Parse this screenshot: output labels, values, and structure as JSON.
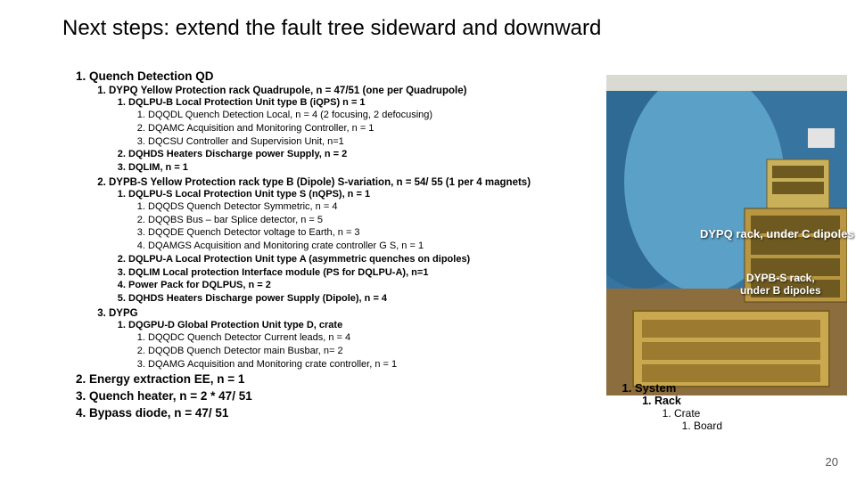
{
  "title": "Next steps: extend the fault tree sideward and downward",
  "outline": {
    "lvl1": {
      "item1": "Quench Detection QD",
      "sub1": {
        "s1": "DYPQ Yellow Protection rack Quadrupole, n = 47/51 (one per Quadrupole)",
        "s1_1": "DQLPU-B Local Protection Unit type B (iQPS) n = 1",
        "s1_1_1": "DQQDL Quench Detection Local, n = 4 (2 focusing, 2 defocusing)",
        "s1_1_2": "DQAMC Acquisition and Monitoring Controller, n = 1",
        "s1_1_3": "DQCSU Controller and Supervision Unit, n=1",
        "s1_2": "DQHDS Heaters Discharge power Supply, n = 2",
        "s1_3": "DQLIM, n = 1",
        "s2": "DYPB-S Yellow Protection rack type B (Dipole) S-variation, n = 54/ 55 (1 per 4 magnets)",
        "s2_1": "DQLPU-S Local Protection Unit type S (nQPS), n = 1",
        "s2_1_1": "DQQDS Quench Detector Symmetric, n = 4",
        "s2_1_2": "DQQBS Bus – bar Splice detector, n = 5",
        "s2_1_3": "DQQDE Quench Detector voltage to Earth, n = 3",
        "s2_1_4": "DQAMGS Acquisition and Monitoring crate controller G S, n = 1",
        "s2_2": "DQLPU-A  Local Protection Unit type A (asymmetric quenches on dipoles)",
        "s2_3": "DQLIM Local protection Interface module (PS for DQLPU-A), n=1",
        "s2_4": "Power Pack for DQLPUS, n = 2",
        "s2_5": "DQHDS Heaters Discharge power Supply (Dipole), n = 4",
        "s3": "DYPG",
        "s3_1": "DQGPU-D Global Protection Unit type D, crate",
        "s3_1_1": "DQQDC Quench Detector Current leads, n = 4",
        "s3_1_2": "DQQDB Quench Detector main Busbar, n= 2",
        "s3_1_3": "DQAMG Acquisition and Monitoring crate controller, n = 1"
      },
      "item2": "Energy extraction EE, n = 1",
      "item3": "Quench heater, n = 2 * 47/ 51",
      "item4": "Bypass diode, n = 47/ 51"
    }
  },
  "captions": {
    "c1": "DYPQ rack, under C dipoles",
    "c2a": "DYPB-S rack,",
    "c2b": "under B dipoles"
  },
  "key": {
    "k1": "System",
    "k2": "Rack",
    "k3": "Crate",
    "k4": "Board"
  },
  "page": "20"
}
